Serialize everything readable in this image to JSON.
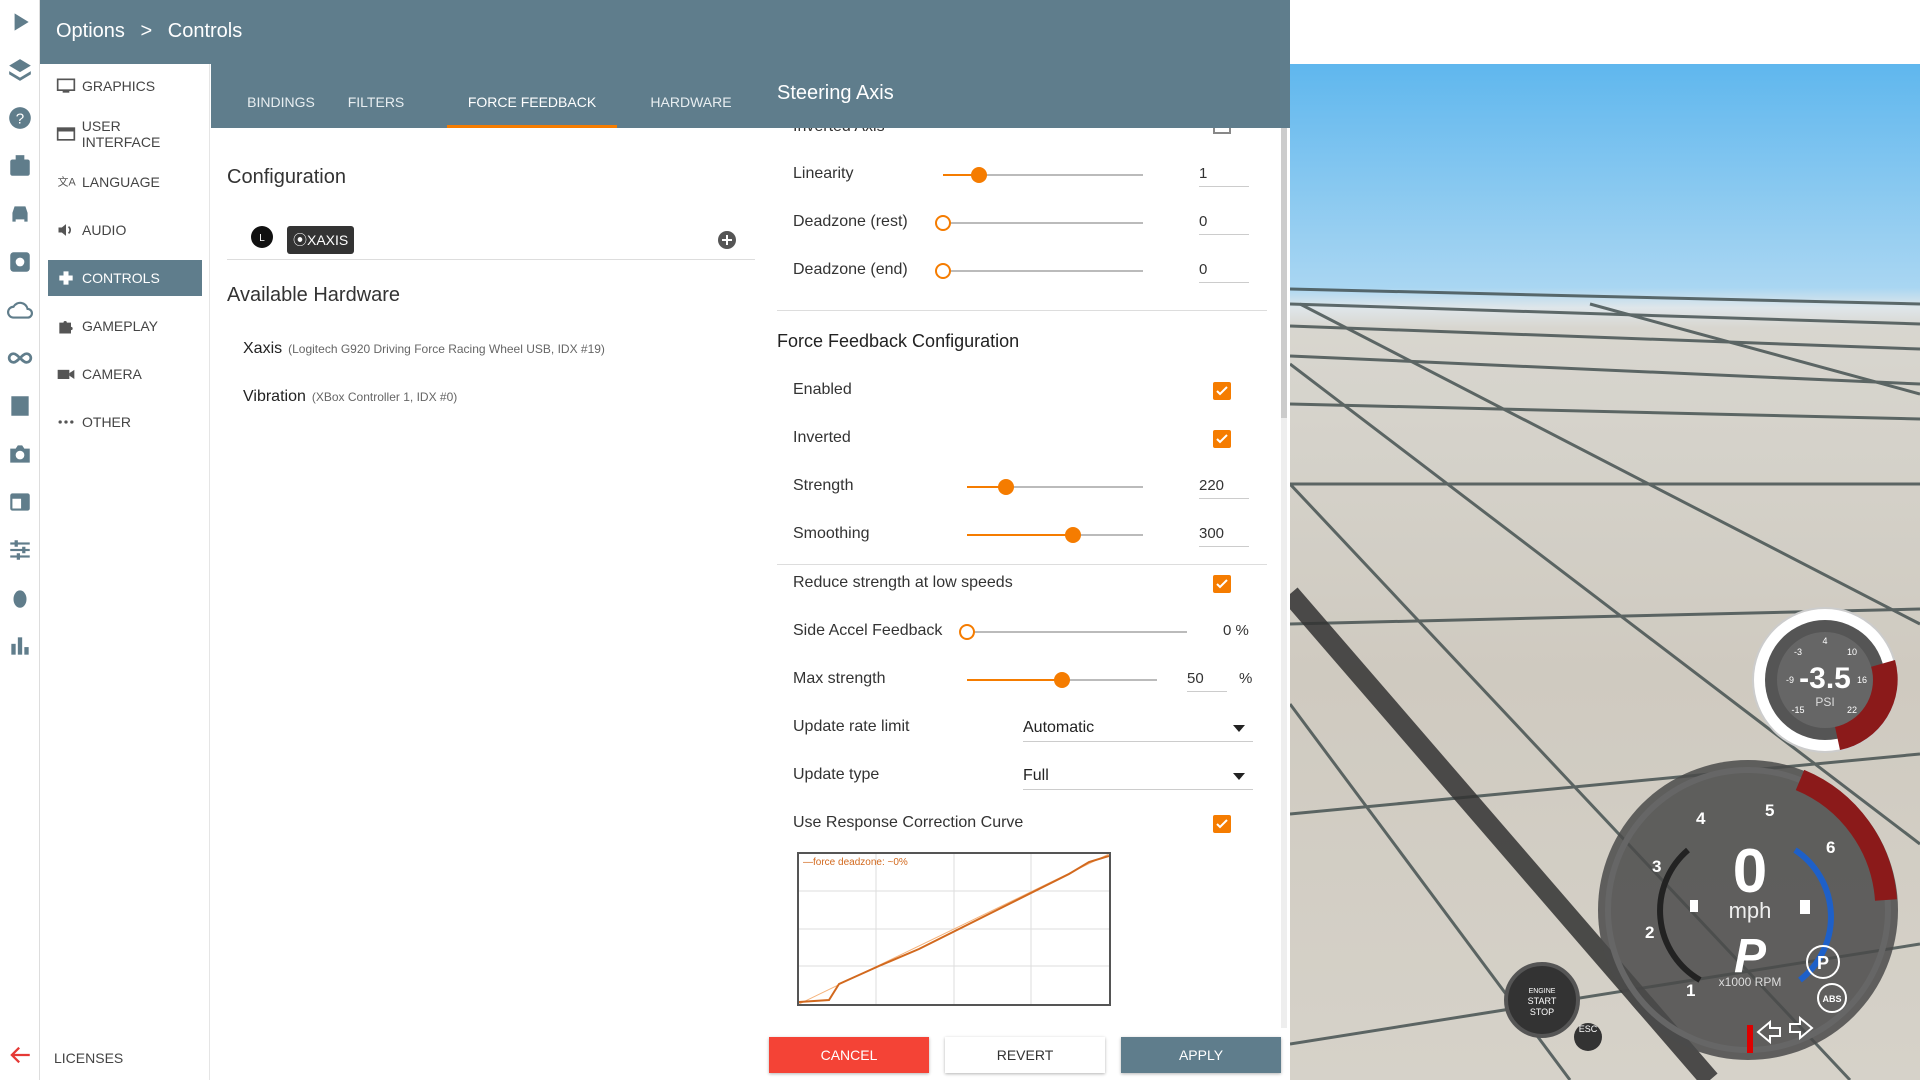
{
  "header": {
    "crumb_root": "Options",
    "crumb_sep": ">",
    "crumb_current": "Controls"
  },
  "rail_icons": [
    "play-icon",
    "layers-icon",
    "help-icon",
    "video-icon",
    "car-icon",
    "settings-icon",
    "cloud-icon",
    "infinity-icon",
    "film-icon",
    "camera-icon",
    "browser-icon",
    "sliders-icon",
    "bug-icon",
    "bar-chart-icon"
  ],
  "nav": {
    "items": [
      {
        "label": "GRAPHICS",
        "icon": "monitor-icon"
      },
      {
        "label": "USER INTERFACE",
        "icon": "ui-icon"
      },
      {
        "label": "LANGUAGE",
        "icon": "translate-icon"
      },
      {
        "label": "AUDIO",
        "icon": "speaker-icon"
      },
      {
        "label": "CONTROLS",
        "icon": "gamepad-icon"
      },
      {
        "label": "GAMEPLAY",
        "icon": "puzzle-icon"
      },
      {
        "label": "CAMERA",
        "icon": "videocam-icon"
      },
      {
        "label": "OTHER",
        "icon": "more-icon"
      }
    ],
    "active": "CONTROLS",
    "licenses": "LICENSES"
  },
  "tabs": [
    "BINDINGS",
    "FILTERS",
    "FORCE FEEDBACK",
    "HARDWARE"
  ],
  "config": {
    "title": "Configuration",
    "device_chip": "⦿XAXIS",
    "hw_title": "Available Hardware",
    "hardware": [
      {
        "name": "Xaxis",
        "detail": "(Logitech G920 Driving Force Racing Wheel USB, IDX #19)"
      },
      {
        "name": "Vibration",
        "detail": "(XBox Controller 1, IDX #0)"
      }
    ]
  },
  "steering": {
    "title": "Steering Axis",
    "cut_label": "Inverted Axis",
    "linearity": {
      "label": "Linearity",
      "value": "1",
      "fraction": 0.18
    },
    "dz_rest": {
      "label": "Deadzone (rest)",
      "value": "0",
      "fraction": 0
    },
    "dz_end": {
      "label": "Deadzone (end)",
      "value": "0",
      "fraction": 0
    },
    "ffb_title": "Force Feedback Configuration",
    "enabled": "Enabled",
    "inverted": "Inverted",
    "strength": {
      "label": "Strength",
      "value": "220",
      "fraction": 0.22
    },
    "smoothing": {
      "label": "Smoothing",
      "value": "300",
      "fraction": 0.6
    },
    "reduce": "Reduce strength at low speeds",
    "side_accel": {
      "label": "Side Accel Feedback",
      "value": "0",
      "unit": "%",
      "fraction": 0
    },
    "max_strength": {
      "label": "Max strength",
      "value": "50",
      "unit": "%",
      "fraction": 0.5
    },
    "update_rate": {
      "label": "Update rate limit",
      "value": "Automatic"
    },
    "update_type": {
      "label": "Update type",
      "value": "Full"
    },
    "curve": {
      "label": "Use Response Correction Curve",
      "legend": "—force deadzone: ~0%"
    }
  },
  "buttons": {
    "cancel": "CANCEL",
    "revert": "REVERT",
    "apply": "APPLY"
  },
  "hud": {
    "boost_value": "-3.5",
    "boost_unit": "PSI",
    "boost_ticks": [
      "-3",
      "4",
      "10",
      "16",
      "22",
      "-15",
      "-9"
    ],
    "speed": "0",
    "speed_unit": "mph",
    "gear": "P",
    "rpm_unit": "x1000 RPM",
    "rpm_ticks": [
      "1",
      "2",
      "3",
      "4",
      "5",
      "6"
    ],
    "engine_button": [
      "ENGINE",
      "START",
      "STOP"
    ],
    "esc_label": "ESC",
    "abs_label": "ABS",
    "parking_label": "P"
  },
  "colors": {
    "accent": "#f57c00",
    "header": "#5f7d8c",
    "cancel": "#f44336"
  }
}
